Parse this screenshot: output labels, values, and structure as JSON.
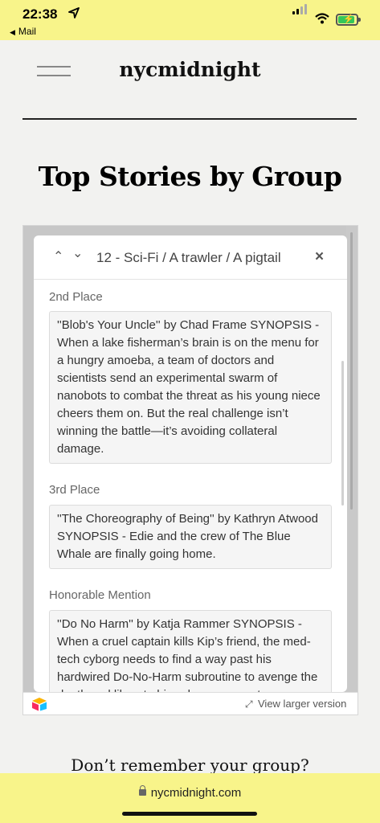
{
  "status": {
    "time": "22:38",
    "back_app": "Mail"
  },
  "header": {
    "brand": "nycmidnight"
  },
  "page": {
    "title": "Top Stories by Group"
  },
  "embed": {
    "panel_title": "12 - Sci-Fi / A trawler / A pigtail",
    "entries": [
      {
        "place": "2nd Place",
        "text": "''Blob's Your Uncle'' by Chad Frame  SYNOPSIS - When a lake fisherman’s brain is on the menu for a hungry amoeba, a team of doctors and scientists send an experimental swarm of nanobots to combat the threat as his young niece cheers them on. But the real challenge isn’t winning the battle—it’s avoiding collateral damage."
      },
      {
        "place": "3rd Place",
        "text": "''The Choreography of Being'' by Kathryn Atwood  SYNOPSIS - Edie and the crew of The Blue Whale are finally going home."
      },
      {
        "place": "Honorable Mention",
        "text": "''Do No Harm'' by Katja Rammer  SYNOPSIS - When a cruel captain kills Kip’s friend, the med-tech cyborg needs to find a way past his hardwired Do-No-Harm subroutine to avenge the death and liberate his cyborg crewmates."
      }
    ],
    "view_larger": "View larger version"
  },
  "footer": {
    "remember": "Don’t remember your group?"
  },
  "browser": {
    "url": "nycmidnight.com"
  },
  "colors": {
    "status_bar": "#f8f48a",
    "page_bg": "#f2f2f0"
  },
  "icons": [
    "location-arrow-icon",
    "signal-icon",
    "wifi-icon",
    "battery-icon",
    "hamburger-menu-icon",
    "chevron-up-icon",
    "chevron-down-icon",
    "close-icon",
    "airtable-logo-icon",
    "expand-icon",
    "lock-icon"
  ]
}
